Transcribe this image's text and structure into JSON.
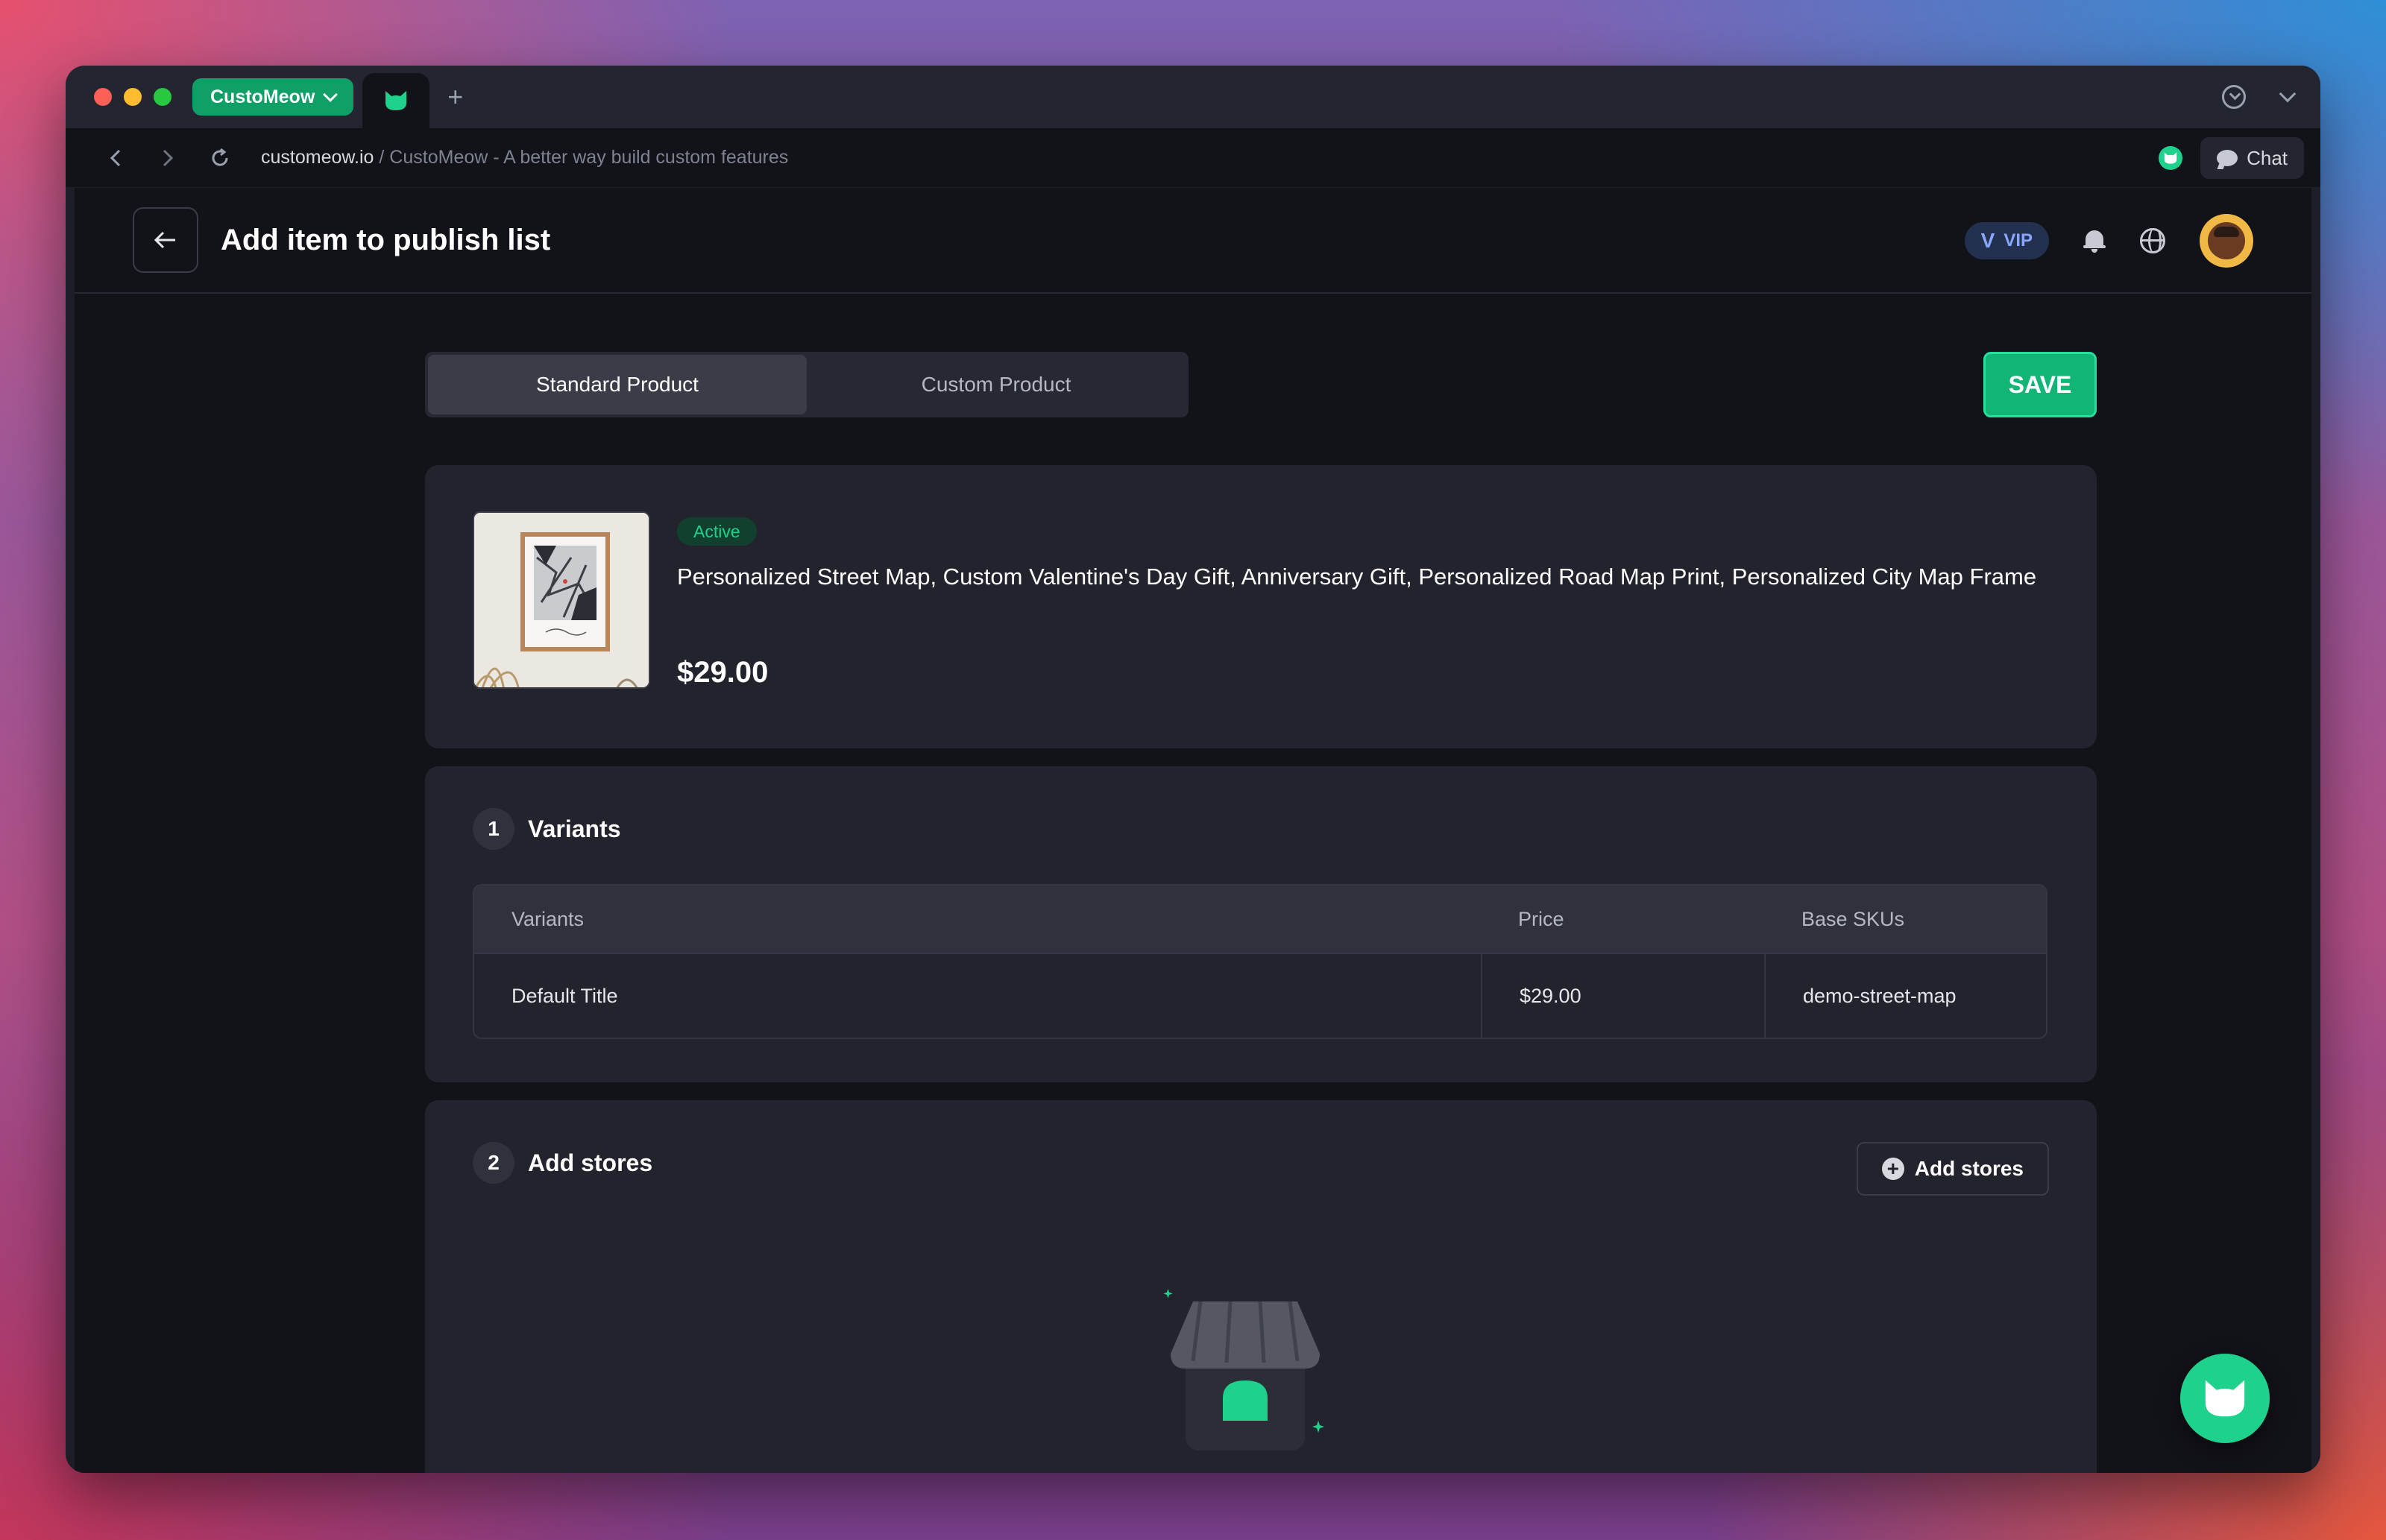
{
  "browser": {
    "tab_label": "CustoMeow",
    "url_host": "customeow.io",
    "url_rest": " / CustoMeow - A better way build custom features",
    "chat_label": "Chat",
    "new_tab": "+"
  },
  "header": {
    "title": "Add item to publish list",
    "vip_label": "VIP",
    "vip_letter": "V"
  },
  "toggle": {
    "options": [
      "Standard Product",
      "Custom Product"
    ],
    "selected": "Standard Product"
  },
  "save_label": "SAVE",
  "product": {
    "status": "Active",
    "title": "Personalized Street Map, Custom Valentine's Day Gift, Anniversary Gift, Personalized Road Map Print, Personalized City Map Frame",
    "price": "$29.00"
  },
  "variants": {
    "step": "1",
    "title": "Variants",
    "columns": [
      "Variants",
      "Price",
      "Base SKUs"
    ],
    "rows": [
      {
        "variant": "Default Title",
        "price": "$29.00",
        "sku": "demo-street-map"
      }
    ]
  },
  "stores": {
    "step": "2",
    "title": "Add stores",
    "button_label": "Add stores"
  },
  "colors": {
    "accent": "#1ed28d",
    "save": "#11b676",
    "bg": "#121219",
    "card": "#22232d"
  },
  "icons": [
    "back-arrow-icon",
    "forward-arrow-icon",
    "reload-icon",
    "cat-logo-icon",
    "chat-bubble-icon",
    "bell-icon",
    "globe-icon",
    "download-icon",
    "chevron-down-icon",
    "plus-circle-icon",
    "store-icon"
  ]
}
